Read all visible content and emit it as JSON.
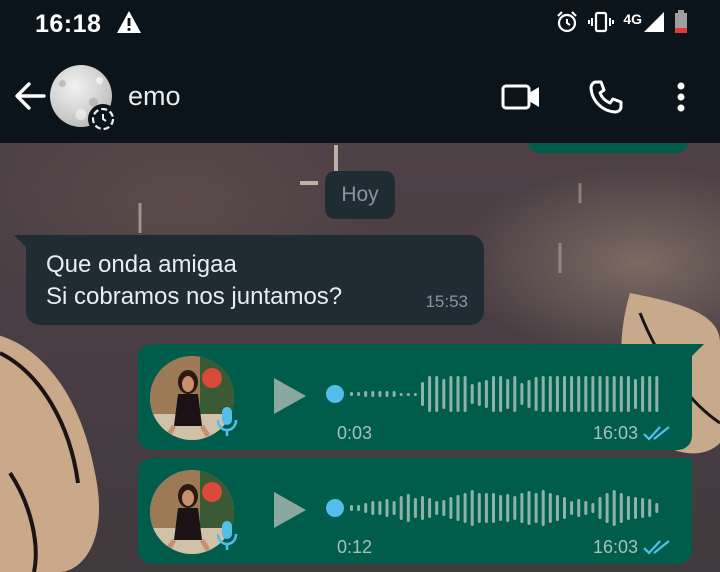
{
  "status_bar": {
    "time": "16:18",
    "network": "4G",
    "icons": [
      "warning-icon",
      "alarm-icon",
      "vibrate-icon",
      "signal-icon",
      "battery-icon"
    ]
  },
  "header": {
    "contact_name": "emo",
    "icons": [
      "back-arrow-icon",
      "avatar",
      "status-ring-icon",
      "video-call-icon",
      "voice-call-icon",
      "more-vert-icon"
    ]
  },
  "chat": {
    "date_chip": "Hoy",
    "messages": [
      {
        "type": "text",
        "direction": "incoming",
        "lines": [
          "Que onda amigaa",
          "Si cobramos nos juntamos?"
        ],
        "time": "15:53"
      },
      {
        "type": "voice",
        "direction": "outgoing",
        "duration": "0:03",
        "time": "16:03",
        "read": true
      },
      {
        "type": "voice",
        "direction": "outgoing",
        "duration": "0:12",
        "time": "16:03",
        "read": true
      }
    ]
  },
  "colors": {
    "app_bar": "#0b141a",
    "incoming_bubble": "#1f2c34",
    "outgoing_bubble": "#005c4b",
    "read_ticks": "#53bdeb",
    "wave_dot": "#53bdeb",
    "meta_text": "#8696a0"
  }
}
